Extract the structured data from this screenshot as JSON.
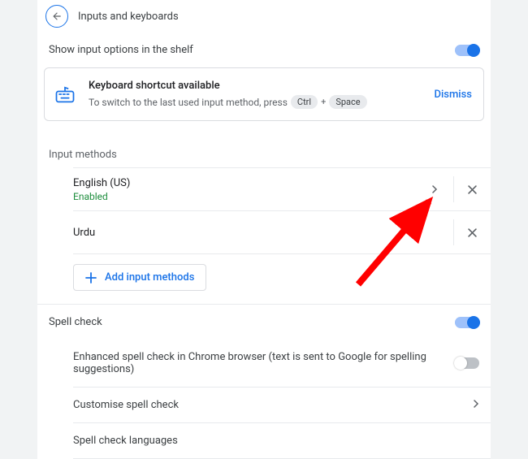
{
  "page": {
    "title": "Inputs and keyboards"
  },
  "shelf": {
    "label": "Show input options in the shelf",
    "enabled": true
  },
  "shortcut_card": {
    "title": "Keyboard shortcut available",
    "subtitle": "To switch to the last used input method, press",
    "key1": "Ctrl",
    "key2": "Space",
    "dismiss": "Dismiss"
  },
  "input_methods": {
    "heading": "Input methods",
    "items": [
      {
        "name": "English (US)",
        "status": "Enabled",
        "has_details": true
      },
      {
        "name": "Urdu",
        "status": "",
        "has_details": false
      }
    ],
    "add_label": "Add input methods"
  },
  "spellcheck": {
    "heading": "Spell check",
    "enabled": true,
    "enhanced": {
      "label": "Enhanced spell check in Chrome browser (text is sent to Google for spelling suggestions)",
      "enabled": false
    },
    "customise": "Customise spell check",
    "languages": "Spell check languages"
  },
  "colors": {
    "accent": "#1a73e8",
    "success": "#1e8e3e"
  }
}
